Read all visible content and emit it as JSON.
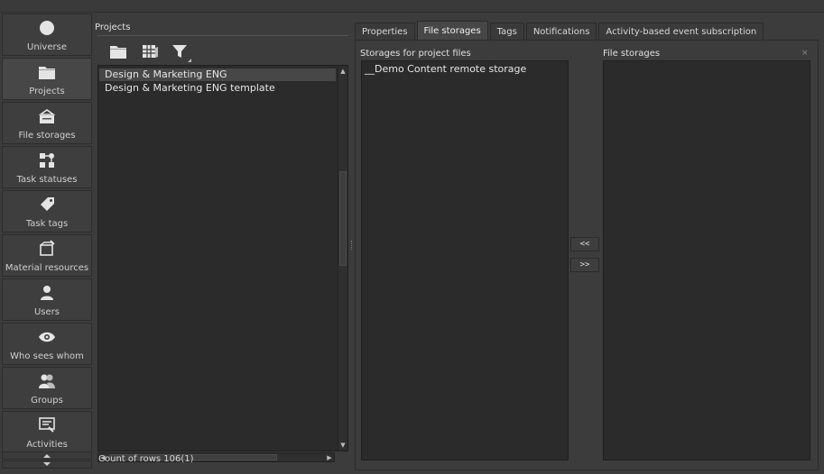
{
  "nav": {
    "items": [
      {
        "label": "Universe",
        "icon": "circle-icon"
      },
      {
        "label": "Projects",
        "icon": "folder-icon"
      },
      {
        "label": "File storages",
        "icon": "file-storage-icon"
      },
      {
        "label": "Task statuses",
        "icon": "task-status-icon"
      },
      {
        "label": "Task tags",
        "icon": "tag-icon"
      },
      {
        "label": "Material resources",
        "icon": "material-resource-icon"
      },
      {
        "label": "Users",
        "icon": "user-icon"
      },
      {
        "label": "Who sees whom",
        "icon": "eye-icon"
      },
      {
        "label": "Groups",
        "icon": "group-icon"
      },
      {
        "label": "Activities",
        "icon": "activities-icon"
      }
    ],
    "active": "Projects"
  },
  "projects": {
    "title": "Projects",
    "toolbar": [
      "folder-icon",
      "database-icon",
      "filter-icon"
    ],
    "rows": [
      "Design & Marketing ENG",
      "Design & Marketing ENG template"
    ],
    "selected_index": 0,
    "count_label": "Count of rows 106(1)"
  },
  "tabs": [
    {
      "label": "Properties"
    },
    {
      "label": "File storages"
    },
    {
      "label": "Tags"
    },
    {
      "label": "Notifications"
    },
    {
      "label": "Activity-based event subscription"
    }
  ],
  "active_tab": "File storages",
  "file_storages": {
    "left_title": "Storages for project files",
    "left_items": [
      "__Demo Content remote storage"
    ],
    "right_title": "File storages",
    "right_items": [],
    "move_left_label": "<<",
    "move_right_label": ">>",
    "close_glyph": "×"
  },
  "colors": {
    "background": "#3c3c3c",
    "list_background": "#2b2b2b",
    "selection": "#474747",
    "text": "#d8d8d8"
  }
}
